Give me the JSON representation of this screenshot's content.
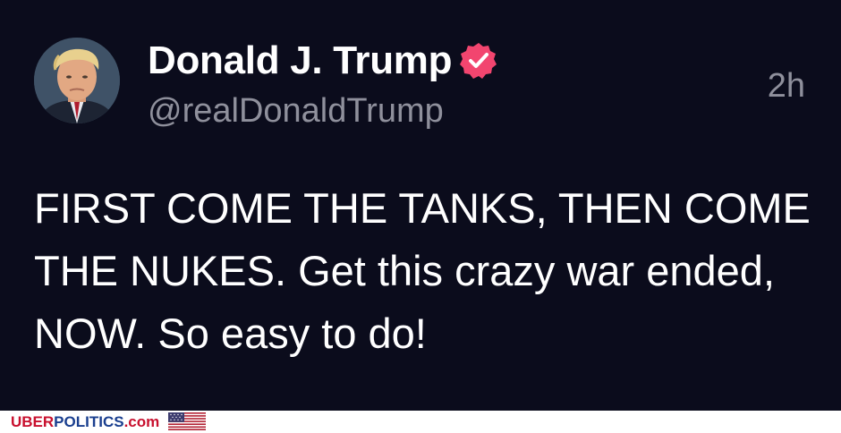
{
  "post": {
    "display_name": "Donald J. Trump",
    "handle": "@realDonaldTrump",
    "timestamp": "2h",
    "verified_icon": "verified-badge-icon",
    "body": "FIRST COME THE TANKS, THEN COME THE NUKES. Get this crazy war ended, NOW. So easy to do!"
  },
  "footer": {
    "brand_part1": "UBER",
    "brand_part2": "POLITICS",
    "brand_part3": ".com",
    "flag_icon": "us-flag-icon"
  },
  "colors": {
    "background": "#0b0c1c",
    "text": "#ffffff",
    "muted": "#8f909c",
    "verified": "#f2456f",
    "brand_red": "#c8102e",
    "brand_blue": "#1a3f8f"
  }
}
